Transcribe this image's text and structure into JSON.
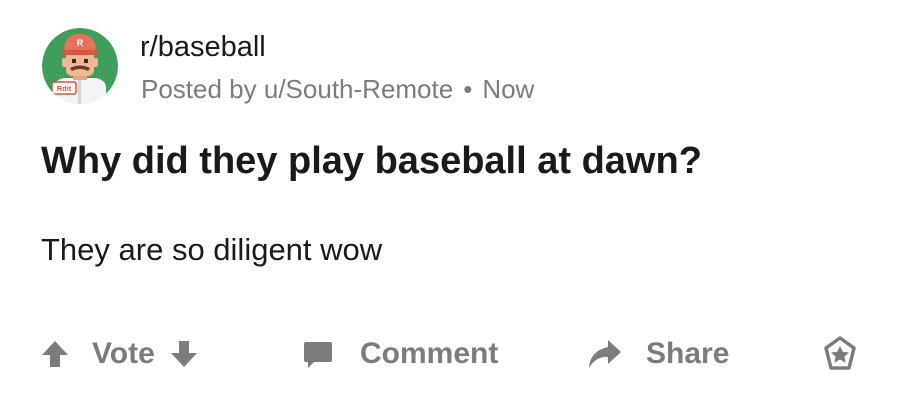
{
  "post": {
    "subreddit": "r/baseball",
    "posted_by_prefix": "Posted by",
    "author": "u/South-Remote",
    "separator": "•",
    "time": "Now",
    "title": "Why did they play baseball at dawn?",
    "body": "They are so diligent wow"
  },
  "avatar": {
    "cap_letter": "R",
    "badge_text": "Rdit",
    "colors": {
      "background": "#3f9e5b",
      "cap": "#e8705a",
      "skin": "#f2b896",
      "mustache": "#6b3a2a",
      "shirt": "#f4f4f4",
      "badge": "#d9573d"
    }
  },
  "actions": {
    "vote_label": "Vote",
    "comment_label": "Comment",
    "share_label": "Share"
  },
  "icons": {
    "upvote": "upvote-arrow-icon",
    "downvote": "downvote-arrow-icon",
    "comment": "comment-bubble-icon",
    "share": "share-arrow-icon",
    "award": "award-icon"
  },
  "colors": {
    "text_primary": "#1a1a1b",
    "text_secondary": "#7c7c7c",
    "icon": "#7c7c7c"
  }
}
